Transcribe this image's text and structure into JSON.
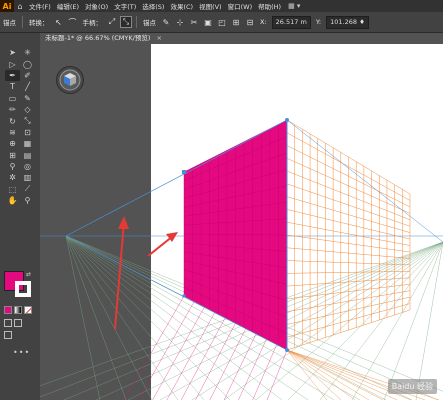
{
  "app": {
    "logo": "Ai",
    "home_icon": "home-icon"
  },
  "menu": [
    "文件(F)",
    "编辑(E)",
    "对象(O)",
    "文字(T)",
    "选择(S)",
    "效果(C)",
    "视图(V)",
    "窗口(W)",
    "帮助(H)"
  ],
  "control": {
    "anchor_label": "锚点",
    "convert_label": "转换：",
    "handle_label": "手柄：",
    "anchor_label2": "锚点",
    "x_value": "26.517 m",
    "y_value": "101.268 ♦"
  },
  "document": {
    "tab_title": "未标题-1* @ 66.67% (CMYK/预览)",
    "close": "×"
  },
  "watermark": "Baidu 经验",
  "colors": {
    "fill": "#e5097f",
    "grid_left": "#e5097f",
    "grid_right": "#f08a3c",
    "ground": "#7aa882",
    "horizon": "#4a90d9",
    "arrow": "#e53935"
  }
}
